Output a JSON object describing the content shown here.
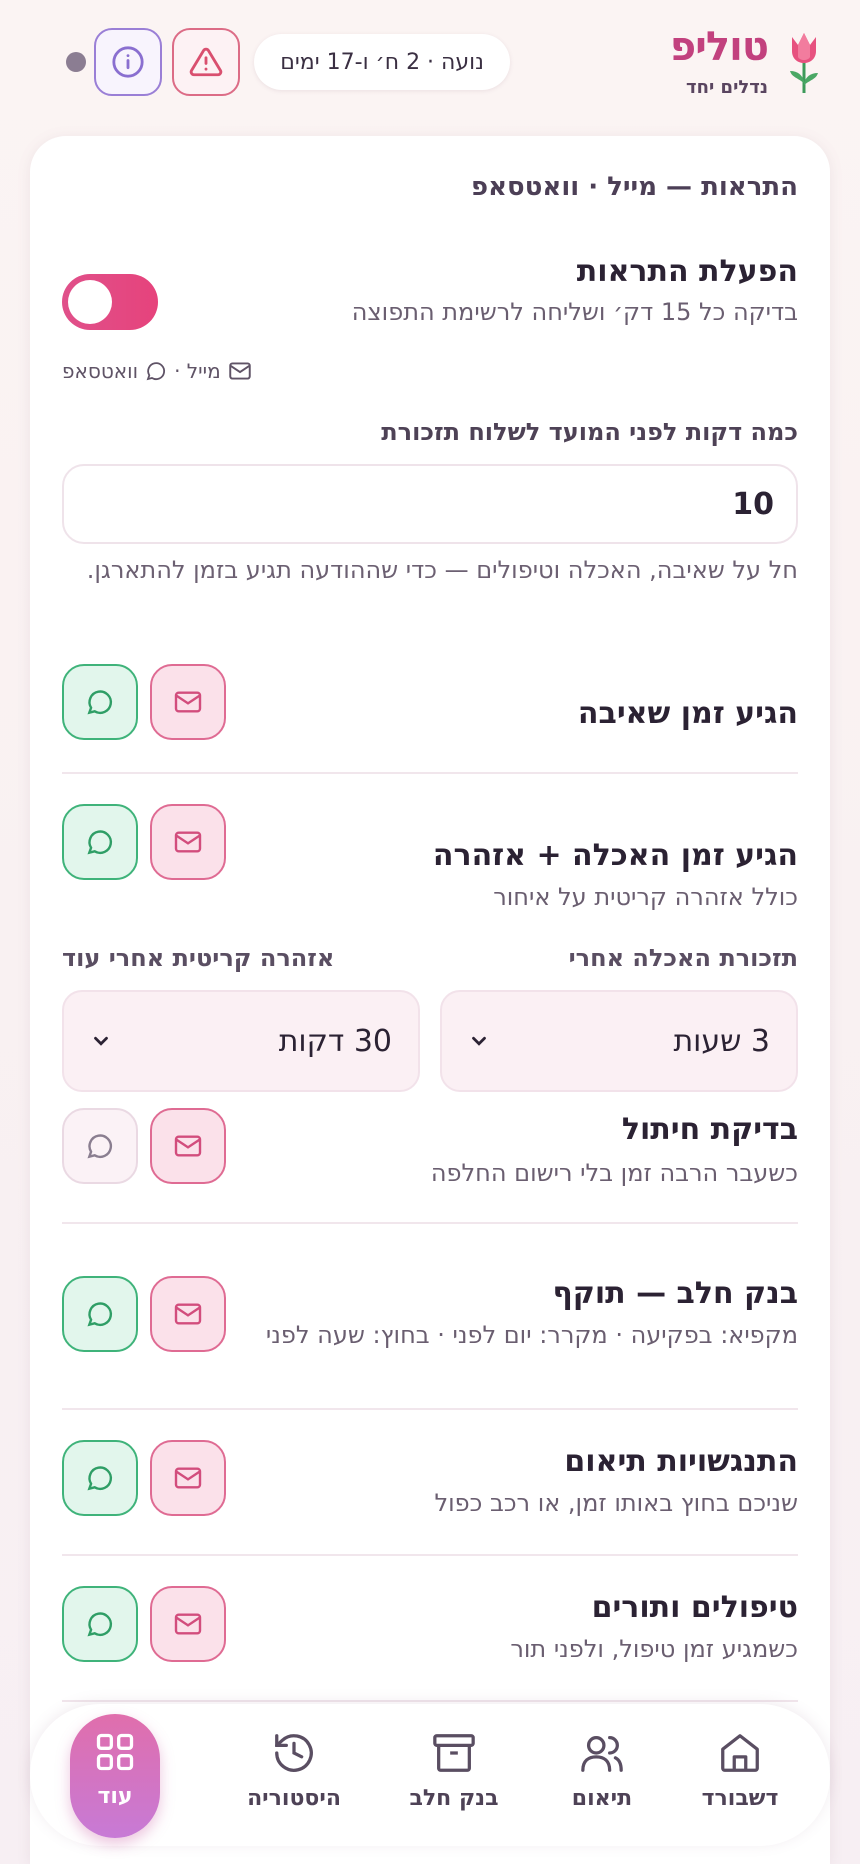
{
  "header": {
    "brand_title": "טוליפ",
    "brand_subtitle": "נדלים יחד",
    "age_label": "נועה · 2 ח׳ ו-17 ימים"
  },
  "card": {
    "section_title": "התראות — מייל · וואטסאפ",
    "enable": {
      "title": "הפעלת התראות",
      "subtitle": "בדיקה כל 15 דק׳ ושליחה לרשימת התפוצה",
      "enabled": true
    },
    "channels_label_mail": "מייל ·",
    "channels_label_whatsapp": "וואטסאפ",
    "minutes": {
      "label": "כמה דקות לפני המועד לשלוח תזכורת",
      "value": "10",
      "help": "חל על שאיבה, האכלה וטיפולים — כדי שההודעה תגיע בזמן להתארגן."
    },
    "alerts": [
      {
        "title": "הגיע זמן שאיבה",
        "subtitle": "",
        "whatsapp_on": true
      },
      {
        "title": "הגיע זמן האכלה + אזהרה",
        "subtitle": "כולל אזהרה קריטית על איחור",
        "whatsapp_on": true
      },
      {
        "title": "בדיקת חיתול",
        "subtitle": "כשעבר הרבה זמן בלי רישום החלפה",
        "whatsapp_on": false
      },
      {
        "title": "בנק חלב — תוקף",
        "subtitle": "מקפיא: בפקיעה · מקרר: יום לפני · בחוץ: שעה לפני",
        "whatsapp_on": true
      },
      {
        "title": "התנגשויות תיאום",
        "subtitle": "שניכם בחוץ באותו זמן, או רכב כפול",
        "whatsapp_on": true
      },
      {
        "title": "טיפולים ותורים",
        "subtitle": "כשמגיע זמן טיפול, ולפני תור",
        "whatsapp_on": true
      }
    ],
    "feeding_reminder": {
      "label": "תזכורת האכלה אחרי",
      "value": "3 שעות"
    },
    "critical_warning": {
      "label": "אזהרה קריטית אחרי עוד",
      "value": "30 דקות"
    }
  },
  "nav": {
    "items": [
      {
        "label": "דשבורד",
        "icon": "home-icon"
      },
      {
        "label": "תיאום",
        "icon": "users-icon"
      },
      {
        "label": "בנק חלב",
        "icon": "archive-icon"
      },
      {
        "label": "היסטוריה",
        "icon": "history-icon"
      },
      {
        "label": "עוד",
        "icon": "grid-icon",
        "active": true
      }
    ]
  },
  "colors": {
    "brand": "#c2417e",
    "toggle_on": "#e0508a",
    "whatsapp": "#3fb37a",
    "mail": "#df6b93",
    "warning": "#dc6c86",
    "info": "#9a7fd6"
  }
}
